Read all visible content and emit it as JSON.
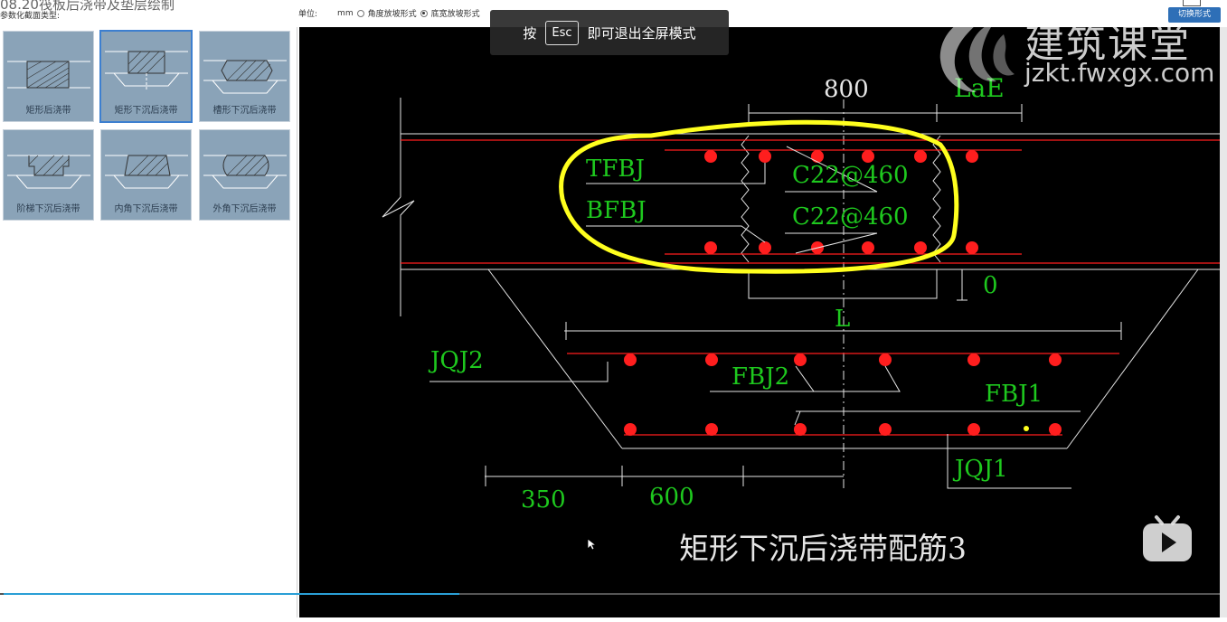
{
  "window": {
    "title": "08.20筏板后浇带及垫层绘制",
    "param_type_label": "参数化截面类型:",
    "top_right_button": "切换形式"
  },
  "section_types": [
    {
      "label": "矩形后浇带",
      "selected": false
    },
    {
      "label": "矩形下沉后浇带",
      "selected": true
    },
    {
      "label": "槽形下沉后浇带",
      "selected": false
    },
    {
      "label": "阶梯下沉后浇带",
      "selected": false
    },
    {
      "label": "内角下沉后浇带",
      "selected": false
    },
    {
      "label": "外角下沉后浇带",
      "selected": false
    }
  ],
  "unit_bar": {
    "unit_label": "单位:",
    "unit_value": "mm",
    "option_1": "角度放坡形式",
    "option_2": "底宽放坡形式",
    "selected_option": 2
  },
  "fullscreen_toast": {
    "prefix": "按",
    "key": "Esc",
    "suffix": "即可退出全屏模式"
  },
  "watermark": {
    "name": "建筑课堂",
    "url": "jzkt.fwxgx.com"
  },
  "drawing": {
    "dim_top": "800",
    "dim_lae": "LaE",
    "tfbj": "TFBJ",
    "bfbj": "BFBJ",
    "rebar_top": "C22@460",
    "rebar_bottom": "C22@460",
    "dim_zero": "0",
    "dim_l": "L",
    "jqj2": "JQJ2",
    "fbj2": "FBJ2",
    "fbj1": "FBJ1",
    "jqj1": "JQJ1",
    "dim_350": "350",
    "dim_600": "600",
    "caption": "矩形下沉后浇带配筋3"
  },
  "colors": {
    "cad_green": "#1ec81e",
    "cad_red": "#ff1e1e",
    "cad_white": "#e6e6e6",
    "highlight_yellow": "#ffff1e",
    "panel_blue": "#8aa3b8",
    "progress_blue": "#2a9fd6"
  },
  "player": {
    "progress": 0.375,
    "play_icon": "bilibili-tv-play-icon"
  }
}
